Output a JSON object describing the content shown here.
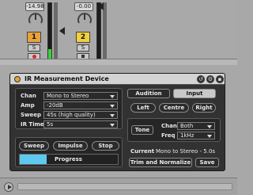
{
  "mixer": {
    "track1": {
      "volume": "-14.98",
      "number": "1",
      "solo": "S",
      "level_fraction": 0.2
    },
    "track2": {
      "volume": "-0.00",
      "number": "2",
      "solo": "S",
      "level_fraction": 0.0
    }
  },
  "device": {
    "title": "IR Measurement Device",
    "params": [
      {
        "label": "Chan",
        "value": "Mono to Stereo"
      },
      {
        "label": "Amp",
        "value": "-20dB"
      },
      {
        "label": "Sweep",
        "value": "45s (high quality)"
      },
      {
        "label": "IR Time",
        "value": "5s"
      }
    ],
    "buttons": {
      "sweep": "Sweep",
      "impulse": "Impulse",
      "stop": "Stop"
    },
    "progress_label": "Progress",
    "progress_fraction": 0.0,
    "tabs": {
      "audition": "Audition",
      "input": "Input",
      "active": "Input"
    },
    "channels": {
      "left": "Left",
      "centre": "Centre",
      "right": "Right"
    },
    "tone": {
      "label": "Tone",
      "chan_label": "Chan",
      "chan_value": "Both",
      "freq_label": "Freq",
      "freq_value": "1kHz"
    },
    "current_label": "Current",
    "current_value": "Mono to Stereo - 5.0s",
    "trim_button": "Trim and Normalize",
    "save_button": "Save"
  },
  "colors": {
    "accent_orange": "#e9a23a",
    "accent_yellow": "#f2d03a",
    "meter_green": "#39d437",
    "progress_blue": "#5fc8ef"
  }
}
